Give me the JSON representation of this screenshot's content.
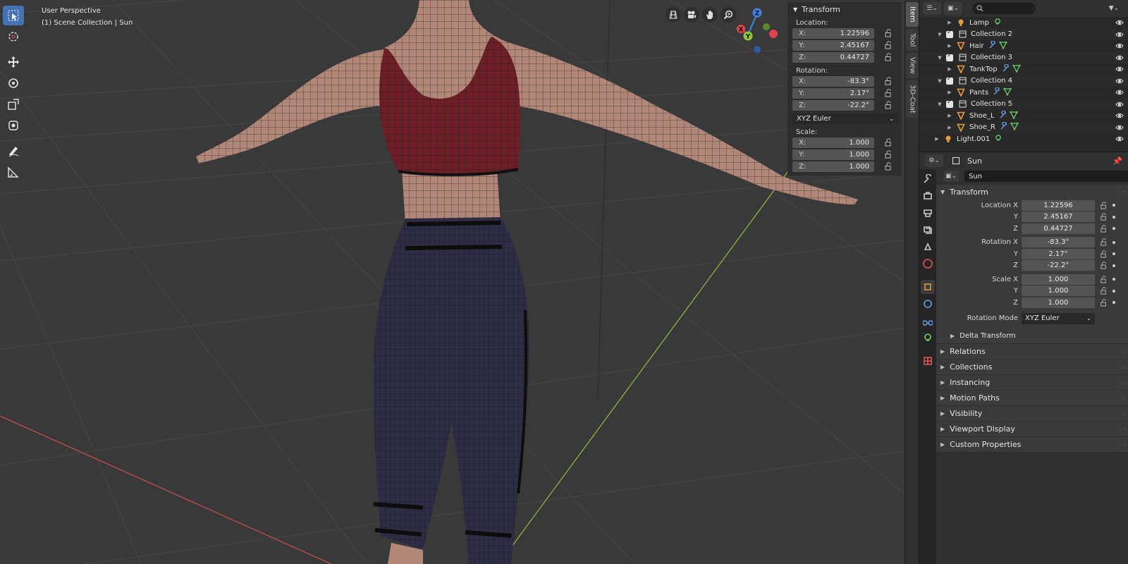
{
  "viewport": {
    "mode_label": "User Perspective",
    "collection_label": "(1) Scene Collection | Sun"
  },
  "tools": [
    "select-box-icon",
    "cursor-icon",
    "move-icon",
    "rotate-icon",
    "scale-icon",
    "transform-icon",
    "annotate-icon",
    "measure-icon"
  ],
  "nav_buttons": [
    "grid-view-icon",
    "camera-view-icon",
    "hand-pan-icon",
    "zoom-icon"
  ],
  "gizmo_axes": {
    "x": "X",
    "y": "Y",
    "z": "Z"
  },
  "npanel": {
    "title": "Transform",
    "location_label": "Location:",
    "rotation_label": "Rotation:",
    "scale_label": "Scale:",
    "location": [
      {
        "axis": "X:",
        "value": "1.22596"
      },
      {
        "axis": "Y:",
        "value": "2.45167"
      },
      {
        "axis": "Z:",
        "value": "0.44727"
      }
    ],
    "rotation": [
      {
        "axis": "X:",
        "value": "-83.3°"
      },
      {
        "axis": "Y:",
        "value": "2.17°"
      },
      {
        "axis": "Z:",
        "value": "-22.2°"
      }
    ],
    "rotation_mode": "XYZ Euler",
    "scale": [
      {
        "axis": "X:",
        "value": "1.000"
      },
      {
        "axis": "Y:",
        "value": "1.000"
      },
      {
        "axis": "Z:",
        "value": "1.000"
      }
    ]
  },
  "side_tabs": [
    "Item",
    "Tool",
    "View",
    "3D-Coat"
  ],
  "outliner": {
    "rows": [
      {
        "name": "Lamp",
        "type": "light"
      },
      {
        "name": "Collection 2",
        "type": "collection"
      },
      {
        "name": "Hair",
        "type": "mesh"
      },
      {
        "name": "Collection 3",
        "type": "collection"
      },
      {
        "name": "TankTop",
        "type": "mesh"
      },
      {
        "name": "Collection 4",
        "type": "collection"
      },
      {
        "name": "Pants",
        "type": "mesh"
      },
      {
        "name": "Collection 5",
        "type": "collection"
      },
      {
        "name": "Shoe_L",
        "type": "mesh"
      },
      {
        "name": "Shoe_R",
        "type": "mesh"
      },
      {
        "name": "Light.001",
        "type": "light"
      }
    ]
  },
  "properties": {
    "header_title": "Sun",
    "object_name": "Sun",
    "transform_title": "Transform",
    "rows": [
      {
        "label": "Location X",
        "value": "1.22596"
      },
      {
        "label": "Y",
        "value": "2.45167"
      },
      {
        "label": "Z",
        "value": "0.44727"
      },
      {
        "label": "Rotation X",
        "value": "-83.3°"
      },
      {
        "label": "Y",
        "value": "2.17°"
      },
      {
        "label": "Z",
        "value": "-22.2°"
      },
      {
        "label": "Scale X",
        "value": "1.000"
      },
      {
        "label": "Y",
        "value": "1.000"
      },
      {
        "label": "Z",
        "value": "1.000"
      }
    ],
    "rotation_mode_label": "Rotation Mode",
    "rotation_mode": "XYZ Euler",
    "delta_transform": "Delta Transform",
    "sections": [
      "Relations",
      "Collections",
      "Instancing",
      "Motion Paths",
      "Visibility",
      "Viewport Display",
      "Custom Properties"
    ]
  },
  "colors": {
    "accent": "#4772b3",
    "x_axis": "#e0434f",
    "y_axis": "#8fc53c",
    "z_axis": "#3d84e0",
    "object_orange": "#e89a3c",
    "top_color": "#6e1f26",
    "pants_color": "#2f2d45",
    "skin_color": "#b28778"
  }
}
